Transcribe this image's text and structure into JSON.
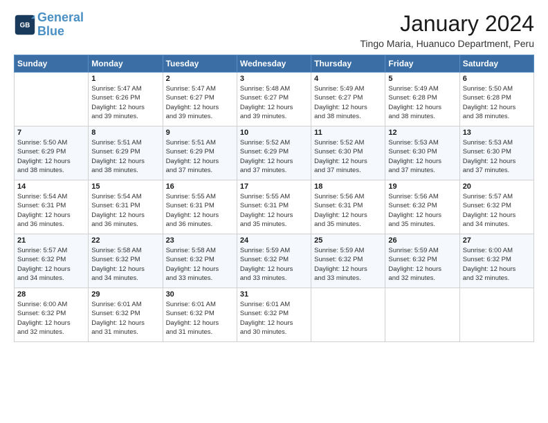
{
  "header": {
    "logo_line1": "General",
    "logo_line2": "Blue",
    "month": "January 2024",
    "location": "Tingo Maria, Huanuco Department, Peru"
  },
  "weekdays": [
    "Sunday",
    "Monday",
    "Tuesday",
    "Wednesday",
    "Thursday",
    "Friday",
    "Saturday"
  ],
  "weeks": [
    [
      {
        "day": "",
        "sunrise": "",
        "sunset": "",
        "daylight": ""
      },
      {
        "day": "1",
        "sunrise": "Sunrise: 5:47 AM",
        "sunset": "Sunset: 6:26 PM",
        "daylight": "Daylight: 12 hours and 39 minutes."
      },
      {
        "day": "2",
        "sunrise": "Sunrise: 5:47 AM",
        "sunset": "Sunset: 6:27 PM",
        "daylight": "Daylight: 12 hours and 39 minutes."
      },
      {
        "day": "3",
        "sunrise": "Sunrise: 5:48 AM",
        "sunset": "Sunset: 6:27 PM",
        "daylight": "Daylight: 12 hours and 39 minutes."
      },
      {
        "day": "4",
        "sunrise": "Sunrise: 5:49 AM",
        "sunset": "Sunset: 6:27 PM",
        "daylight": "Daylight: 12 hours and 38 minutes."
      },
      {
        "day": "5",
        "sunrise": "Sunrise: 5:49 AM",
        "sunset": "Sunset: 6:28 PM",
        "daylight": "Daylight: 12 hours and 38 minutes."
      },
      {
        "day": "6",
        "sunrise": "Sunrise: 5:50 AM",
        "sunset": "Sunset: 6:28 PM",
        "daylight": "Daylight: 12 hours and 38 minutes."
      }
    ],
    [
      {
        "day": "7",
        "sunrise": "Sunrise: 5:50 AM",
        "sunset": "Sunset: 6:29 PM",
        "daylight": "Daylight: 12 hours and 38 minutes."
      },
      {
        "day": "8",
        "sunrise": "Sunrise: 5:51 AM",
        "sunset": "Sunset: 6:29 PM",
        "daylight": "Daylight: 12 hours and 38 minutes."
      },
      {
        "day": "9",
        "sunrise": "Sunrise: 5:51 AM",
        "sunset": "Sunset: 6:29 PM",
        "daylight": "Daylight: 12 hours and 37 minutes."
      },
      {
        "day": "10",
        "sunrise": "Sunrise: 5:52 AM",
        "sunset": "Sunset: 6:29 PM",
        "daylight": "Daylight: 12 hours and 37 minutes."
      },
      {
        "day": "11",
        "sunrise": "Sunrise: 5:52 AM",
        "sunset": "Sunset: 6:30 PM",
        "daylight": "Daylight: 12 hours and 37 minutes."
      },
      {
        "day": "12",
        "sunrise": "Sunrise: 5:53 AM",
        "sunset": "Sunset: 6:30 PM",
        "daylight": "Daylight: 12 hours and 37 minutes."
      },
      {
        "day": "13",
        "sunrise": "Sunrise: 5:53 AM",
        "sunset": "Sunset: 6:30 PM",
        "daylight": "Daylight: 12 hours and 37 minutes."
      }
    ],
    [
      {
        "day": "14",
        "sunrise": "Sunrise: 5:54 AM",
        "sunset": "Sunset: 6:31 PM",
        "daylight": "Daylight: 12 hours and 36 minutes."
      },
      {
        "day": "15",
        "sunrise": "Sunrise: 5:54 AM",
        "sunset": "Sunset: 6:31 PM",
        "daylight": "Daylight: 12 hours and 36 minutes."
      },
      {
        "day": "16",
        "sunrise": "Sunrise: 5:55 AM",
        "sunset": "Sunset: 6:31 PM",
        "daylight": "Daylight: 12 hours and 36 minutes."
      },
      {
        "day": "17",
        "sunrise": "Sunrise: 5:55 AM",
        "sunset": "Sunset: 6:31 PM",
        "daylight": "Daylight: 12 hours and 35 minutes."
      },
      {
        "day": "18",
        "sunrise": "Sunrise: 5:56 AM",
        "sunset": "Sunset: 6:31 PM",
        "daylight": "Daylight: 12 hours and 35 minutes."
      },
      {
        "day": "19",
        "sunrise": "Sunrise: 5:56 AM",
        "sunset": "Sunset: 6:32 PM",
        "daylight": "Daylight: 12 hours and 35 minutes."
      },
      {
        "day": "20",
        "sunrise": "Sunrise: 5:57 AM",
        "sunset": "Sunset: 6:32 PM",
        "daylight": "Daylight: 12 hours and 34 minutes."
      }
    ],
    [
      {
        "day": "21",
        "sunrise": "Sunrise: 5:57 AM",
        "sunset": "Sunset: 6:32 PM",
        "daylight": "Daylight: 12 hours and 34 minutes."
      },
      {
        "day": "22",
        "sunrise": "Sunrise: 5:58 AM",
        "sunset": "Sunset: 6:32 PM",
        "daylight": "Daylight: 12 hours and 34 minutes."
      },
      {
        "day": "23",
        "sunrise": "Sunrise: 5:58 AM",
        "sunset": "Sunset: 6:32 PM",
        "daylight": "Daylight: 12 hours and 33 minutes."
      },
      {
        "day": "24",
        "sunrise": "Sunrise: 5:59 AM",
        "sunset": "Sunset: 6:32 PM",
        "daylight": "Daylight: 12 hours and 33 minutes."
      },
      {
        "day": "25",
        "sunrise": "Sunrise: 5:59 AM",
        "sunset": "Sunset: 6:32 PM",
        "daylight": "Daylight: 12 hours and 33 minutes."
      },
      {
        "day": "26",
        "sunrise": "Sunrise: 5:59 AM",
        "sunset": "Sunset: 6:32 PM",
        "daylight": "Daylight: 12 hours and 32 minutes."
      },
      {
        "day": "27",
        "sunrise": "Sunrise: 6:00 AM",
        "sunset": "Sunset: 6:32 PM",
        "daylight": "Daylight: 12 hours and 32 minutes."
      }
    ],
    [
      {
        "day": "28",
        "sunrise": "Sunrise: 6:00 AM",
        "sunset": "Sunset: 6:32 PM",
        "daylight": "Daylight: 12 hours and 32 minutes."
      },
      {
        "day": "29",
        "sunrise": "Sunrise: 6:01 AM",
        "sunset": "Sunset: 6:32 PM",
        "daylight": "Daylight: 12 hours and 31 minutes."
      },
      {
        "day": "30",
        "sunrise": "Sunrise: 6:01 AM",
        "sunset": "Sunset: 6:32 PM",
        "daylight": "Daylight: 12 hours and 31 minutes."
      },
      {
        "day": "31",
        "sunrise": "Sunrise: 6:01 AM",
        "sunset": "Sunset: 6:32 PM",
        "daylight": "Daylight: 12 hours and 30 minutes."
      },
      {
        "day": "",
        "sunrise": "",
        "sunset": "",
        "daylight": ""
      },
      {
        "day": "",
        "sunrise": "",
        "sunset": "",
        "daylight": ""
      },
      {
        "day": "",
        "sunrise": "",
        "sunset": "",
        "daylight": ""
      }
    ]
  ]
}
